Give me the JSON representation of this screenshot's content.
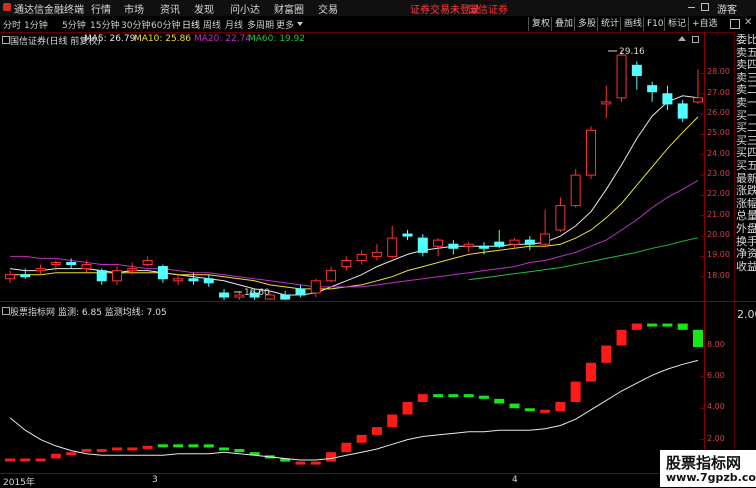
{
  "topbar": {
    "app_title": "通达信金融终端",
    "menus": [
      "行情",
      "市场",
      "资讯",
      "发现",
      "问小达",
      "财富圈",
      "交易"
    ],
    "status_text": "证券交易未登录",
    "broker_text": "国信证券",
    "guest_label": "游客",
    "colors": {
      "status": "#ff4040",
      "broker": "#ff3030"
    }
  },
  "periods": [
    "分时",
    "1分钟",
    "5分钟",
    "15分钟",
    "30分钟",
    "60分钟",
    "日线",
    "周线",
    "月线",
    "多周期",
    "更多"
  ],
  "active_period": "日线",
  "toolbar_buttons": [
    "复权",
    "叠加",
    "多股",
    "统计",
    "画线",
    "F10",
    "标记",
    "+自选"
  ],
  "main_chart": {
    "stock_title": "国信证券(日线 前复权)",
    "ma": [
      {
        "label": "MA5: 26.79",
        "color": "#e8e8e8"
      },
      {
        "label": "MA10: 25.86",
        "color": "#e8e030"
      },
      {
        "label": "MA20: 22.74",
        "color": "#c030c0"
      },
      {
        "label": "MA60: 19.92",
        "color": "#20c040"
      }
    ],
    "high_annotation": "29.16",
    "low_annotation": "16.60",
    "price_ticks": [
      "28.00",
      "27.00",
      "26.00",
      "25.00",
      "24.00",
      "23.00",
      "22.00",
      "21.00",
      "20.00",
      "19.00",
      "18.00"
    ]
  },
  "side_panel": {
    "labels": [
      "委比",
      "卖五",
      "卖四",
      "卖三",
      "卖二",
      "卖一",
      "买一",
      "买二",
      "买三",
      "买四",
      "买五",
      "最新",
      "涨跌",
      "涨幅",
      "总量",
      "外盘",
      "换手",
      "净资",
      "收益"
    ]
  },
  "indicator": {
    "title": "股票指标网",
    "values": "监测: 6.85  监测均线: 7.05",
    "ticks": [
      "8.00",
      "6.00",
      "4.00",
      "2.00"
    ],
    "right_label": "2.00"
  },
  "date_axis": {
    "year_label": "2015年",
    "marks": [
      "3",
      "4"
    ]
  },
  "watermark": {
    "title": "股票指标网",
    "url": "www.7gpzb.com"
  },
  "chart_data": [
    {
      "type": "candlestick",
      "title": "国信证券(日线 前复权)",
      "ylim": [
        17.2,
        29.3
      ],
      "candles": [
        {
          "o": 17.9,
          "c": 18.1,
          "h": 18.3,
          "l": 17.7
        },
        {
          "o": 18.1,
          "c": 18.0,
          "h": 18.4,
          "l": 17.9
        },
        {
          "o": 18.3,
          "c": 18.4,
          "h": 18.6,
          "l": 18.1
        },
        {
          "o": 18.6,
          "c": 18.7,
          "h": 18.8,
          "l": 18.3
        },
        {
          "o": 18.7,
          "c": 18.6,
          "h": 18.9,
          "l": 18.4
        },
        {
          "o": 18.4,
          "c": 18.6,
          "h": 18.8,
          "l": 18.2
        },
        {
          "o": 18.3,
          "c": 17.8,
          "h": 18.4,
          "l": 17.6
        },
        {
          "o": 17.8,
          "c": 18.3,
          "h": 18.5,
          "l": 17.6
        },
        {
          "o": 18.3,
          "c": 18.4,
          "h": 18.7,
          "l": 18.1
        },
        {
          "o": 18.6,
          "c": 18.8,
          "h": 19.0,
          "l": 18.5
        },
        {
          "o": 18.5,
          "c": 17.9,
          "h": 18.6,
          "l": 17.7
        },
        {
          "o": 17.8,
          "c": 17.9,
          "h": 18.1,
          "l": 17.6
        },
        {
          "o": 17.9,
          "c": 17.8,
          "h": 18.2,
          "l": 17.6
        },
        {
          "o": 17.9,
          "c": 17.7,
          "h": 18.1,
          "l": 17.5
        },
        {
          "o": 17.2,
          "c": 17.0,
          "h": 17.4,
          "l": 16.8
        },
        {
          "o": 17.0,
          "c": 17.1,
          "h": 17.3,
          "l": 16.6
        },
        {
          "o": 17.2,
          "c": 17.0,
          "h": 17.4,
          "l": 16.8
        },
        {
          "o": 16.9,
          "c": 17.1,
          "h": 17.3,
          "l": 16.7
        },
        {
          "o": 17.1,
          "c": 16.9,
          "h": 17.3,
          "l": 16.7
        },
        {
          "o": 17.4,
          "c": 17.1,
          "h": 17.6,
          "l": 17.0
        },
        {
          "o": 17.2,
          "c": 17.8,
          "h": 17.9,
          "l": 17.0
        },
        {
          "o": 17.8,
          "c": 18.3,
          "h": 18.5,
          "l": 17.7
        },
        {
          "o": 18.5,
          "c": 18.8,
          "h": 19.0,
          "l": 18.3
        },
        {
          "o": 18.8,
          "c": 19.1,
          "h": 19.3,
          "l": 18.6
        },
        {
          "o": 19.0,
          "c": 19.2,
          "h": 19.6,
          "l": 18.8
        },
        {
          "o": 19.0,
          "c": 19.9,
          "h": 20.5,
          "l": 18.9
        },
        {
          "o": 20.1,
          "c": 20.0,
          "h": 20.3,
          "l": 19.8
        },
        {
          "o": 19.9,
          "c": 19.2,
          "h": 20.1,
          "l": 19.0
        },
        {
          "o": 19.5,
          "c": 19.8,
          "h": 19.9,
          "l": 19.0
        },
        {
          "o": 19.6,
          "c": 19.4,
          "h": 19.8,
          "l": 19.1
        },
        {
          "o": 19.5,
          "c": 19.6,
          "h": 19.7,
          "l": 19.2
        },
        {
          "o": 19.5,
          "c": 19.4,
          "h": 19.7,
          "l": 19.1
        },
        {
          "o": 19.7,
          "c": 19.5,
          "h": 20.3,
          "l": 19.4
        },
        {
          "o": 19.6,
          "c": 19.8,
          "h": 19.9,
          "l": 19.4
        },
        {
          "o": 19.8,
          "c": 19.6,
          "h": 20.0,
          "l": 19.3
        },
        {
          "o": 19.6,
          "c": 20.1,
          "h": 21.3,
          "l": 19.5
        },
        {
          "o": 20.3,
          "c": 21.5,
          "h": 21.9,
          "l": 20.2
        },
        {
          "o": 21.5,
          "c": 23.0,
          "h": 23.3,
          "l": 21.4
        },
        {
          "o": 23.0,
          "c": 25.2,
          "h": 25.4,
          "l": 22.8
        },
        {
          "o": 26.5,
          "c": 26.6,
          "h": 27.4,
          "l": 25.8
        },
        {
          "o": 26.8,
          "c": 28.9,
          "h": 29.16,
          "l": 26.6
        },
        {
          "o": 28.4,
          "c": 27.9,
          "h": 28.6,
          "l": 27.2
        },
        {
          "o": 27.4,
          "c": 27.1,
          "h": 27.6,
          "l": 26.6
        },
        {
          "o": 27.0,
          "c": 26.5,
          "h": 27.4,
          "l": 26.2
        },
        {
          "o": 26.5,
          "c": 25.8,
          "h": 26.7,
          "l": 25.6
        },
        {
          "o": 26.6,
          "c": 26.8,
          "h": 28.2,
          "l": 26.5
        }
      ],
      "series": [
        {
          "name": "MA5",
          "values": [
            18.4,
            18.3,
            18.3,
            18.4,
            18.4,
            18.4,
            18.3,
            18.2,
            18.3,
            18.3,
            18.2,
            18.1,
            18.0,
            17.9,
            17.8,
            17.6,
            17.4,
            17.3,
            17.1,
            17.1,
            17.2,
            17.5,
            17.8,
            18.1,
            18.5,
            18.8,
            19.1,
            19.3,
            19.4,
            19.5,
            19.5,
            19.5,
            19.5,
            19.6,
            19.6,
            19.7,
            20.0,
            20.5,
            21.2,
            22.3,
            23.5,
            24.8,
            25.9,
            26.6,
            26.9,
            26.8
          ]
        },
        {
          "name": "MA10",
          "values": [
            18.1,
            18.1,
            18.1,
            18.2,
            18.2,
            18.2,
            18.2,
            18.2,
            18.2,
            18.2,
            18.2,
            18.1,
            18.1,
            18.1,
            18.0,
            17.9,
            17.8,
            17.6,
            17.5,
            17.4,
            17.4,
            17.4,
            17.5,
            17.6,
            17.8,
            18.0,
            18.3,
            18.5,
            18.7,
            18.9,
            19.1,
            19.2,
            19.3,
            19.4,
            19.5,
            19.5,
            19.6,
            19.9,
            20.3,
            20.9,
            21.6,
            22.5,
            23.4,
            24.3,
            25.1,
            25.86
          ]
        },
        {
          "name": "MA20",
          "values": [
            19.0,
            19.0,
            18.9,
            18.9,
            18.8,
            18.7,
            18.6,
            18.6,
            18.5,
            18.4,
            18.4,
            18.3,
            18.2,
            18.2,
            18.1,
            18.0,
            17.9,
            17.8,
            17.7,
            17.6,
            17.5,
            17.5,
            17.5,
            17.5,
            17.6,
            17.7,
            17.8,
            17.9,
            18.0,
            18.1,
            18.2,
            18.3,
            18.4,
            18.5,
            18.7,
            18.8,
            19.0,
            19.2,
            19.5,
            19.8,
            20.3,
            20.8,
            21.4,
            21.9,
            22.3,
            22.74
          ]
        },
        {
          "name": "MA60",
          "values": [
            null,
            null,
            null,
            null,
            null,
            null,
            null,
            null,
            null,
            null,
            null,
            null,
            null,
            null,
            null,
            null,
            null,
            null,
            null,
            null,
            null,
            null,
            null,
            null,
            null,
            null,
            null,
            null,
            null,
            null,
            17.85,
            17.95,
            18.05,
            18.15,
            18.25,
            18.35,
            18.45,
            18.6,
            18.75,
            18.9,
            19.05,
            19.2,
            19.4,
            19.55,
            19.75,
            19.92
          ]
        }
      ]
    },
    {
      "type": "bar",
      "title": "股票指标网",
      "ylim": [
        0,
        9.5
      ],
      "values": [
        0.8,
        0.8,
        0.8,
        1.1,
        1.2,
        1.4,
        1.4,
        1.5,
        1.5,
        1.6,
        1.7,
        1.7,
        1.7,
        1.5,
        1.4,
        1.2,
        1.0,
        0.8,
        0.6,
        0.5,
        0.6,
        1.2,
        1.8,
        2.3,
        2.8,
        3.6,
        4.4,
        4.9,
        4.9,
        4.9,
        4.8,
        4.6,
        4.3,
        4.0,
        3.9,
        3.8,
        4.4,
        5.7,
        6.9,
        8.0,
        9.0,
        9.4,
        9.4,
        9.4,
        9.0,
        7.9
      ],
      "directions": [
        "up",
        "up",
        "up",
        "up",
        "up",
        "up",
        "up",
        "up",
        "up",
        "up",
        "dn",
        "dn",
        "dn",
        "dn",
        "dn",
        "dn",
        "dn",
        "dn",
        "dn",
        "up",
        "up",
        "up",
        "up",
        "up",
        "up",
        "up",
        "up",
        "up",
        "dn",
        "dn",
        "dn",
        "dn",
        "dn",
        "dn",
        "dn",
        "up",
        "up",
        "up",
        "up",
        "up",
        "up",
        "up",
        "dn",
        "dn",
        "dn",
        "dn"
      ],
      "series": [
        {
          "name": "监测均线",
          "values": [
            3.4,
            2.6,
            2.0,
            1.6,
            1.3,
            1.1,
            1.0,
            1.0,
            1.0,
            1.0,
            1.0,
            1.1,
            1.1,
            1.1,
            1.2,
            1.1,
            1.0,
            0.9,
            0.8,
            0.7,
            0.7,
            0.8,
            1.0,
            1.2,
            1.4,
            1.7,
            2.0,
            2.2,
            2.3,
            2.4,
            2.5,
            2.5,
            2.6,
            2.6,
            2.6,
            2.7,
            2.9,
            3.3,
            3.9,
            4.5,
            5.1,
            5.6,
            6.1,
            6.5,
            6.8,
            7.05
          ]
        }
      ]
    }
  ]
}
